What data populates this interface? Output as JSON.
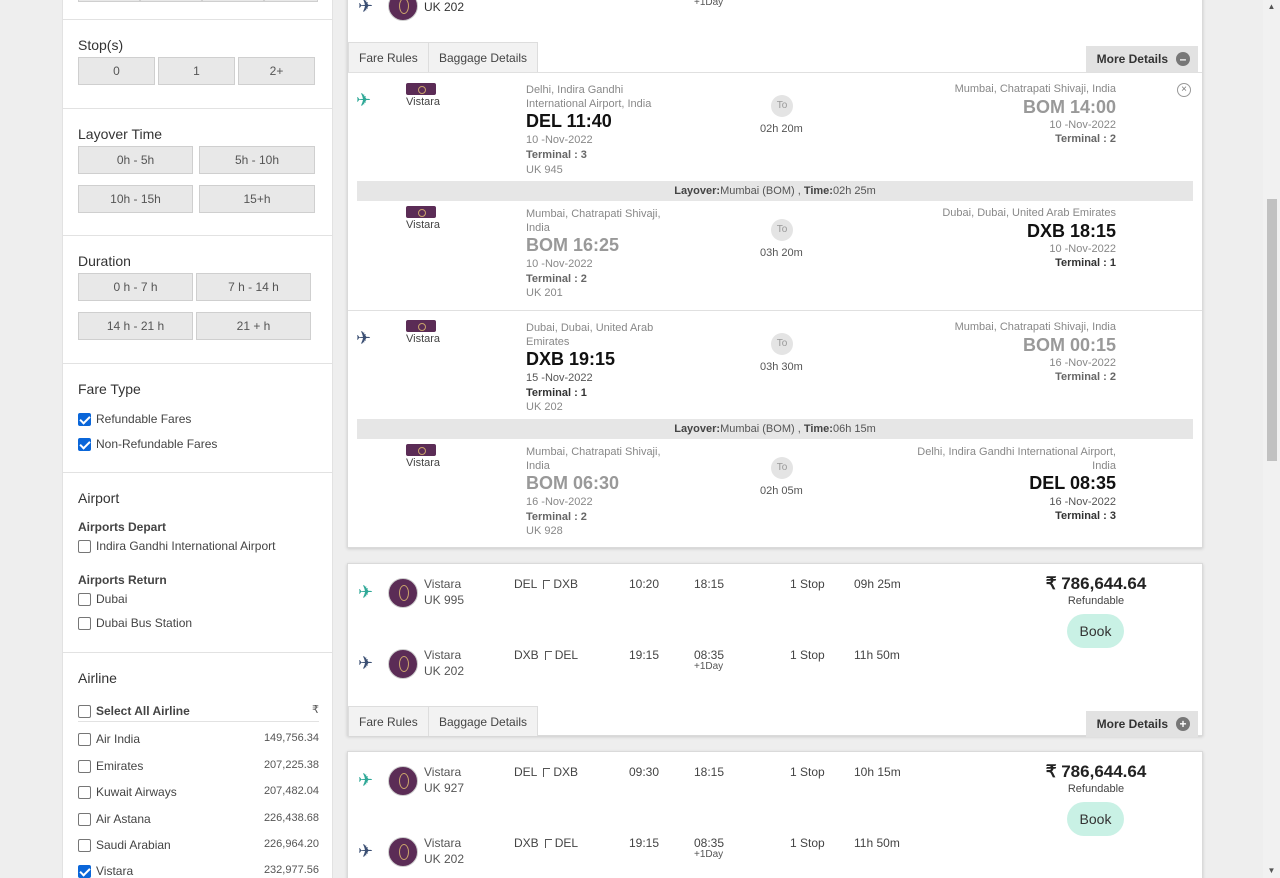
{
  "filters": {
    "stops": {
      "title": "Stop(s)",
      "options": [
        "0",
        "1",
        "2+"
      ]
    },
    "layover": {
      "title": "Layover Time",
      "options": [
        "0h - 5h",
        "5h - 10h",
        "10h - 15h",
        "15+h"
      ]
    },
    "duration": {
      "title": "Duration",
      "options": [
        "0 h - 7 h",
        "7 h - 14 h",
        "14 h - 21 h",
        "21 + h"
      ]
    },
    "fare_type": {
      "title": "Fare Type",
      "options": [
        {
          "label": "Refundable Fares",
          "checked": true
        },
        {
          "label": "Non-Refundable Fares",
          "checked": true
        }
      ]
    },
    "airport": {
      "title": "Airport",
      "depart_title": "Airports Depart",
      "depart": [
        {
          "label": "Indira Gandhi International Airport",
          "checked": false
        }
      ],
      "return_title": "Airports Return",
      "return": [
        {
          "label": "Dubai",
          "checked": false
        },
        {
          "label": "Dubai Bus Station",
          "checked": false
        }
      ]
    },
    "airline": {
      "title": "Airline",
      "select_all": "Select All Airline",
      "currency": "₹",
      "items": [
        {
          "name": "Air India",
          "price": "149,756.34",
          "checked": false
        },
        {
          "name": "Emirates",
          "price": "207,225.38",
          "checked": false
        },
        {
          "name": "Kuwait Airways",
          "price": "207,482.04",
          "checked": false
        },
        {
          "name": "Air Astana",
          "price": "226,438.68",
          "checked": false
        },
        {
          "name": "Saudi Arabian",
          "price": "226,964.20",
          "checked": false
        },
        {
          "name": "Vistara",
          "price": "232,977.56",
          "checked": true
        }
      ]
    }
  },
  "top_card": {
    "partial": {
      "flight_no": "UK 202",
      "next_day": "+1Day"
    },
    "tabs": [
      "Fare Rules",
      "Baggage Details"
    ],
    "more_details": "More Details",
    "to_label": "To",
    "segments": [
      {
        "airline": "Vistara",
        "from_city": "Delhi, Indira Gandhi International Airport, India",
        "from_code_time": "DEL 11:40",
        "from_date": "10 -Nov-2022",
        "from_terminal": "Terminal : 3",
        "flight_no": "UK 945",
        "duration": "02h 20m",
        "to_city": "Mumbai, Chatrapati Shivaji, India",
        "to_code_time": "BOM 14:00",
        "to_date": "10 -Nov-2022",
        "to_terminal": "Terminal : 2"
      },
      {
        "airline": "Vistara",
        "from_city": "Mumbai, Chatrapati Shivaji, India",
        "from_code_time": "BOM 16:25",
        "from_date": "10 -Nov-2022",
        "from_terminal": "Terminal : 2",
        "flight_no": "UK 201",
        "duration": "03h 20m",
        "to_city": "Dubai, Dubai, United Arab Emirates",
        "to_code_time": "DXB 18:15",
        "to_date": "10 -Nov-2022",
        "to_terminal": "Terminal : 1"
      },
      {
        "airline": "Vistara",
        "from_city": "Dubai, Dubai, United Arab Emirates",
        "from_code_time": "DXB 19:15",
        "from_date": "15 -Nov-2022",
        "from_terminal": "Terminal : 1",
        "flight_no": "UK 202",
        "duration": "03h 30m",
        "to_city": "Mumbai, Chatrapati Shivaji, India",
        "to_code_time": "BOM 00:15",
        "to_date": "16 -Nov-2022",
        "to_terminal": "Terminal : 2"
      },
      {
        "airline": "Vistara",
        "from_city": "Mumbai, Chatrapati Shivaji, India",
        "from_code_time": "BOM 06:30",
        "from_date": "16 -Nov-2022",
        "from_terminal": "Terminal : 2",
        "flight_no": "UK 928",
        "duration": "02h 05m",
        "to_city": "Delhi, Indira Gandhi International Airport, India",
        "to_code_time": "DEL 08:35",
        "to_date": "16 -Nov-2022",
        "to_terminal": "Terminal : 3"
      }
    ],
    "layovers": [
      {
        "label": "Layover:",
        "place": "Mumbai (BOM) ,",
        "time_label": "Time:",
        "time": "02h 25m"
      },
      {
        "label": "Layover:",
        "place": "Mumbai (BOM) ,",
        "time_label": "Time:",
        "time": "06h 15m"
      }
    ]
  },
  "results": [
    {
      "price": "₹ 786,644.64",
      "refund": "Refundable",
      "book": "Book",
      "tabs": [
        "Fare Rules",
        "Baggage Details"
      ],
      "more_details": "More Details",
      "legs": [
        {
          "airline": "Vistara",
          "flight_no": "UK 995",
          "from": "DEL",
          "to": "DXB",
          "dep": "10:20",
          "arr": "18:15",
          "next_day": "",
          "stops": "1 Stop",
          "duration": "09h 25m"
        },
        {
          "airline": "Vistara",
          "flight_no": "UK 202",
          "from": "DXB",
          "to": "DEL",
          "dep": "19:15",
          "arr": "08:35",
          "next_day": "+1Day",
          "stops": "1 Stop",
          "duration": "11h 50m"
        }
      ]
    },
    {
      "price": "₹ 786,644.64",
      "refund": "Refundable",
      "book": "Book",
      "legs": [
        {
          "airline": "Vistara",
          "flight_no": "UK 927",
          "from": "DEL",
          "to": "DXB",
          "dep": "09:30",
          "arr": "18:15",
          "next_day": "",
          "stops": "1 Stop",
          "duration": "10h 15m"
        },
        {
          "airline": "Vistara",
          "flight_no": "UK 202",
          "from": "DXB",
          "to": "DEL",
          "dep": "19:15",
          "arr": "08:35",
          "next_day": "+1Day",
          "stops": "1 Stop",
          "duration": "11h 50m"
        }
      ]
    }
  ]
}
